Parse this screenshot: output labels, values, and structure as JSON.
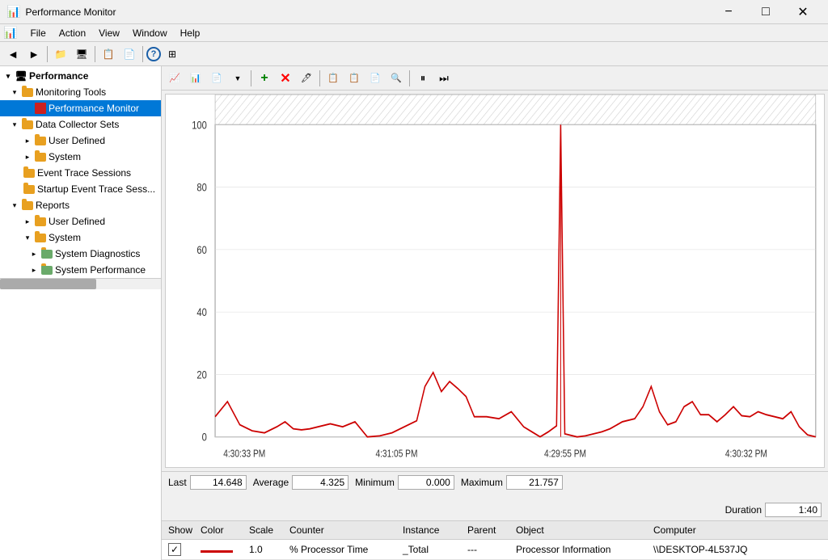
{
  "window": {
    "title": "Performance Monitor",
    "icon": "📊"
  },
  "menu": {
    "items": [
      "File",
      "Action",
      "View",
      "Window",
      "Help"
    ]
  },
  "toolbar": {
    "buttons": [
      "back",
      "forward",
      "up",
      "show-desktop",
      "collapse-tree",
      "properties",
      "help",
      "more"
    ]
  },
  "chart_toolbar": {
    "buttons": [
      "view-graph",
      "view-histogram",
      "view-report",
      "dropdown",
      "add-counter",
      "delete",
      "highlight",
      "copy-properties",
      "paste-properties",
      "properties",
      "zoom",
      "freeze",
      "next"
    ]
  },
  "sidebar": {
    "root": "Performance",
    "items": [
      {
        "id": "monitoring-tools",
        "label": "Monitoring Tools",
        "level": 1,
        "expanded": true,
        "icon": "folder",
        "hasArrow": true
      },
      {
        "id": "performance-monitor",
        "label": "Performance Monitor",
        "level": 2,
        "expanded": false,
        "icon": "perf",
        "hasArrow": false,
        "selected": true
      },
      {
        "id": "data-collector-sets",
        "label": "Data Collector Sets",
        "level": 1,
        "expanded": true,
        "icon": "folder",
        "hasArrow": true
      },
      {
        "id": "user-defined",
        "label": "User Defined",
        "level": 2,
        "expanded": false,
        "icon": "folder",
        "hasArrow": true
      },
      {
        "id": "system",
        "label": "System",
        "level": 2,
        "expanded": false,
        "icon": "folder",
        "hasArrow": true
      },
      {
        "id": "event-trace-sessions",
        "label": "Event Trace Sessions",
        "level": 2,
        "expanded": false,
        "icon": "folder",
        "hasArrow": false
      },
      {
        "id": "startup-event-trace",
        "label": "Startup Event Trace Sess...",
        "level": 2,
        "expanded": false,
        "icon": "folder",
        "hasArrow": false
      },
      {
        "id": "reports",
        "label": "Reports",
        "level": 1,
        "expanded": true,
        "icon": "folder",
        "hasArrow": true
      },
      {
        "id": "reports-user-defined",
        "label": "User Defined",
        "level": 2,
        "expanded": false,
        "icon": "folder",
        "hasArrow": true
      },
      {
        "id": "reports-system",
        "label": "System",
        "level": 2,
        "expanded": true,
        "icon": "folder",
        "hasArrow": true
      },
      {
        "id": "system-diagnostics",
        "label": "System Diagnostics",
        "level": 3,
        "expanded": false,
        "icon": "report",
        "hasArrow": true
      },
      {
        "id": "system-performance",
        "label": "System Performance",
        "level": 3,
        "expanded": false,
        "icon": "report",
        "hasArrow": true
      }
    ]
  },
  "stats": {
    "last_label": "Last",
    "last_value": "14.648",
    "average_label": "Average",
    "average_value": "4.325",
    "minimum_label": "Minimum",
    "minimum_value": "0.000",
    "maximum_label": "Maximum",
    "maximum_value": "21.757",
    "duration_label": "Duration",
    "duration_value": "1:40"
  },
  "x_axis": {
    "labels": [
      "4:30:33 PM",
      "4:31:05 PM",
      "4:29:55 PM",
      "4:30:32 PM"
    ]
  },
  "y_axis": {
    "labels": [
      "100",
      "80",
      "60",
      "40",
      "20",
      "0"
    ]
  },
  "counter_table": {
    "headers": [
      "Show",
      "Color",
      "Scale",
      "Counter",
      "Instance",
      "Parent",
      "Object",
      "Computer"
    ],
    "rows": [
      {
        "show": true,
        "color": "#cc0000",
        "scale": "1.0",
        "counter": "% Processor Time",
        "instance": "_Total",
        "parent": "---",
        "object": "Processor Information",
        "computer": "\\\\DESKTOP-4L537JQ"
      }
    ]
  }
}
